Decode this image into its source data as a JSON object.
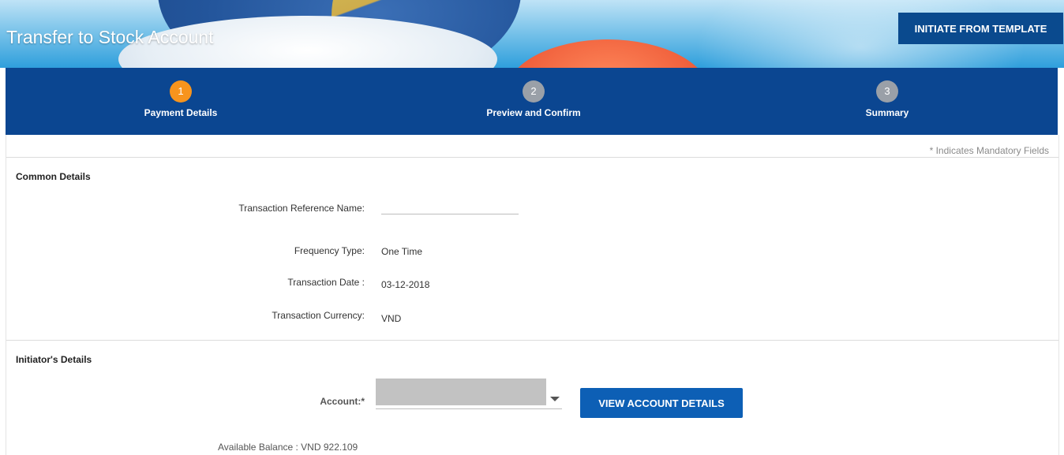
{
  "header": {
    "title": "Transfer to Stock Account",
    "template_button": "INITIATE FROM TEMPLATE"
  },
  "stepper": {
    "steps": [
      {
        "number": "1",
        "label": "Payment Details",
        "state": "active"
      },
      {
        "number": "2",
        "label": "Preview and Confirm",
        "state": "inactive"
      },
      {
        "number": "3",
        "label": "Summary",
        "state": "inactive"
      }
    ]
  },
  "form": {
    "mandatory_note": "* Indicates Mandatory Fields",
    "common_details": {
      "title": "Common Details",
      "reference_name_label": "Transaction Reference Name:",
      "reference_name_value": "",
      "frequency_label": "Frequency Type:",
      "frequency_value": "One Time",
      "date_label": "Transaction Date :",
      "date_value": "03-12-2018",
      "currency_label": "Transaction Currency:",
      "currency_value": "VND"
    },
    "initiator_details": {
      "title": "Initiator's Details",
      "account_label": "Account:*",
      "view_account_button": "VIEW ACCOUNT DETAILS",
      "available_balance": "Available Balance : VND  922.109"
    }
  },
  "colors": {
    "stepper_bg": "#0b4691",
    "active_step": "#f7941d",
    "inactive_step": "#9aa0a8",
    "primary_button": "#0d5fb5"
  }
}
